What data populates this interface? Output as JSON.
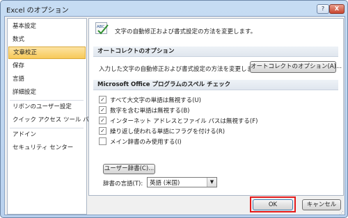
{
  "window": {
    "title": "Excel のオプション",
    "help": "?",
    "close": "X"
  },
  "sidebar": {
    "items": [
      {
        "label": "基本設定",
        "active": false
      },
      {
        "label": "数式",
        "active": false
      },
      {
        "label": "文章校正",
        "active": true
      },
      {
        "label": "保存",
        "active": false
      },
      {
        "label": "言語",
        "active": false
      },
      {
        "label": "詳細設定",
        "active": false
      },
      {
        "label": "リボンのユーザー設定",
        "active": false
      },
      {
        "label": "クイック アクセス ツール バー",
        "active": false
      },
      {
        "label": "アドイン",
        "active": false
      },
      {
        "label": "セキュリティ センター",
        "active": false
      }
    ]
  },
  "main": {
    "header_icon_text": "ABC",
    "header_text": "文字の自動修正および書式設定の方法を変更します。",
    "autocorrect_section": {
      "title": "オートコレクトのオプション",
      "description": "入力した文字の自動修正および書式設定の方法を変更します:",
      "button": "オートコレクトのオプション(A)..."
    },
    "spelling_section": {
      "title": "Microsoft Office プログラムのスペル チェック",
      "options": [
        {
          "label": "すべて大文字の単語は無視する(U)",
          "checked": true
        },
        {
          "label": "数字を含む単語は無視する(B)",
          "checked": true
        },
        {
          "label": "インターネット アドレスとファイル パスは無視する(F)",
          "checked": true
        },
        {
          "label": "繰り返し使われる単語にフラグを付ける(R)",
          "checked": true
        },
        {
          "label": "メイン辞書のみ使用する(I)",
          "checked": false
        }
      ],
      "dictionary_button": "ユーザー辞書(C)...",
      "language_label": "辞書の言語(T):",
      "language_value": "英語 (米国)"
    }
  },
  "footer": {
    "ok": "OK",
    "cancel": "キャンセル"
  },
  "colors": {
    "frame": "#b9d1ee",
    "selected_item": "#f7c959",
    "highlight_border": "#e41b1b"
  }
}
